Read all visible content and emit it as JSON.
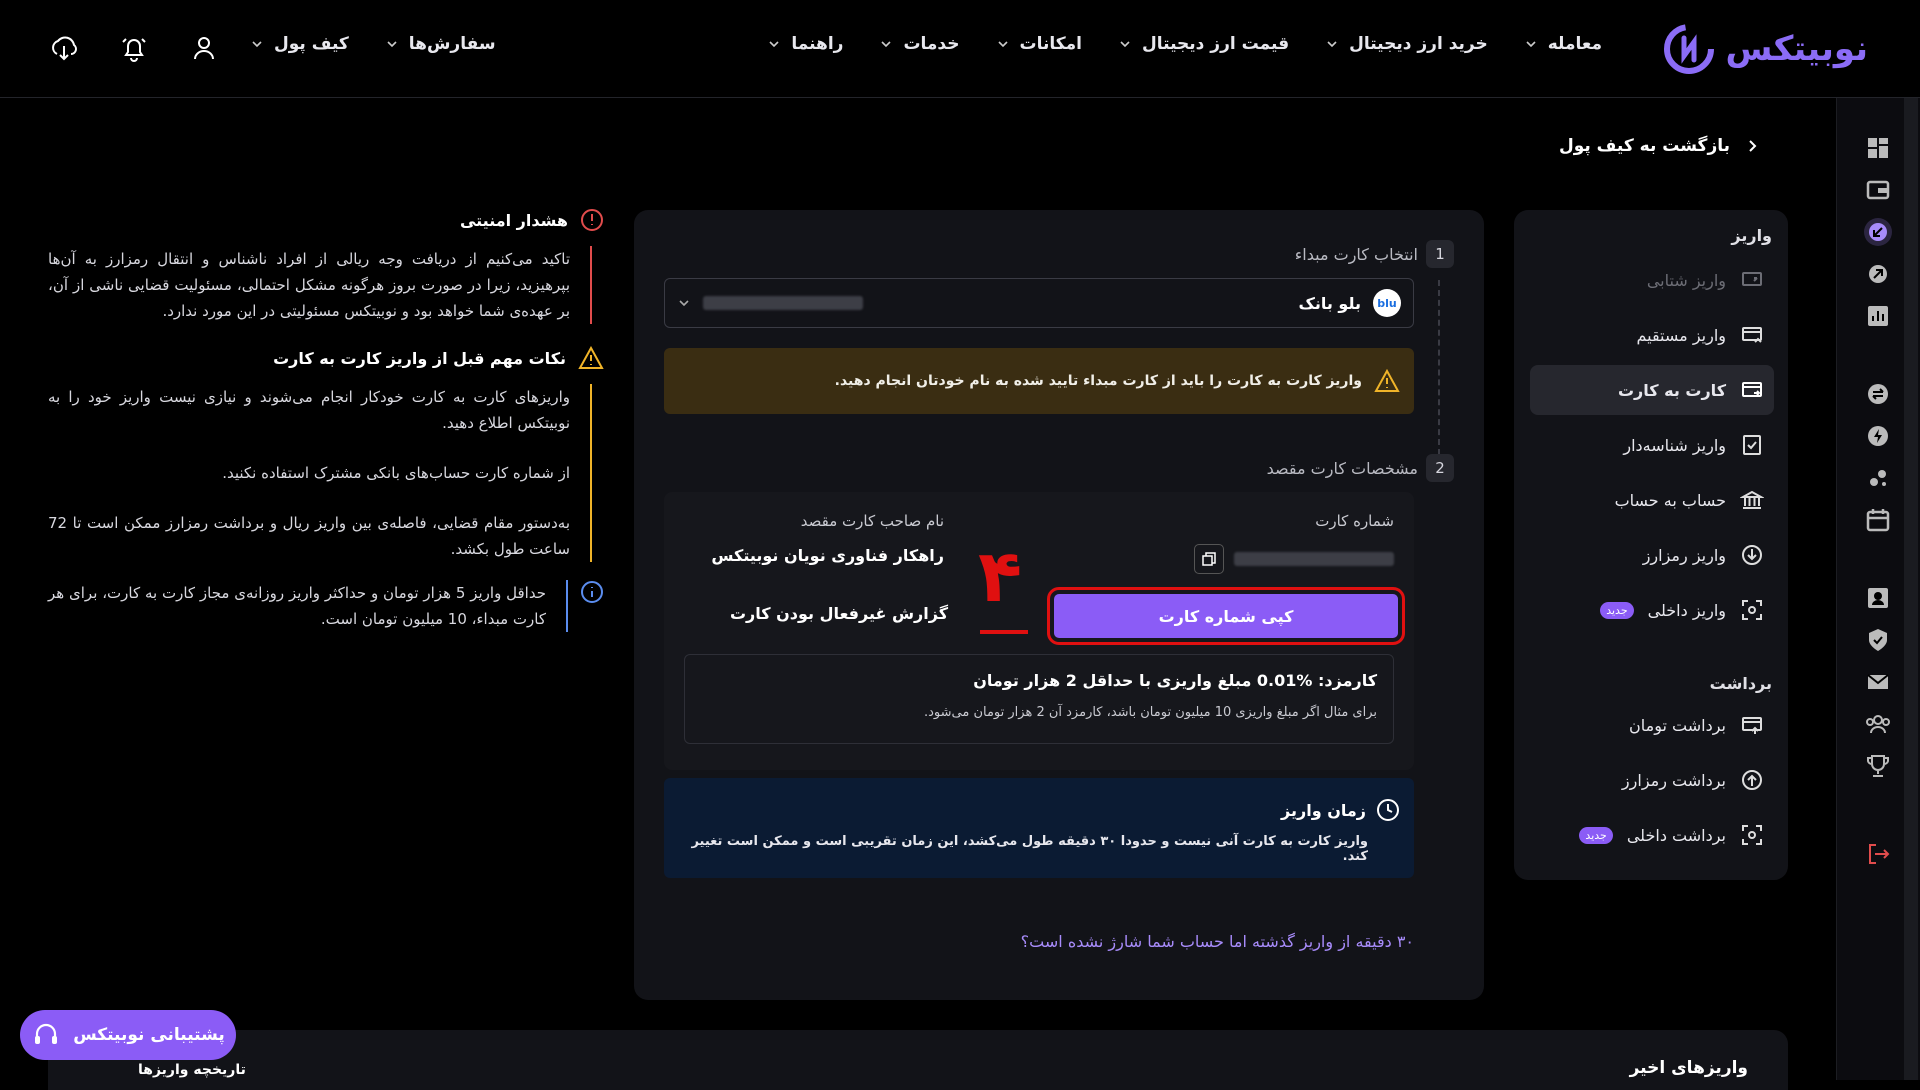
{
  "brand": {
    "name": "نوبیتکس",
    "color": "#8b6cf6"
  },
  "nav": {
    "items": [
      {
        "label": "معامله"
      },
      {
        "label": "خرید ارز دیجیتال"
      },
      {
        "label": "قیمت ارز دیجیتال"
      },
      {
        "label": "امکانات"
      },
      {
        "label": "خدمات"
      },
      {
        "label": "راهنما"
      }
    ],
    "left_items": [
      {
        "label": "سفارش‌ها"
      },
      {
        "label": "کیف پول"
      }
    ]
  },
  "breadcrumb": {
    "label": "بازگشت به کیف پول"
  },
  "sidebar": {
    "deposit_section": "واریز",
    "deposit_items": [
      {
        "label": "واریز شتابی",
        "icon": "fast-deposit-icon",
        "state": "disabled"
      },
      {
        "label": "واریز مستقیم",
        "icon": "direct-deposit-icon"
      },
      {
        "label": "کارت به کارت",
        "icon": "card-to-card-icon",
        "state": "active"
      },
      {
        "label": "واریز شناسه‌دار",
        "icon": "id-deposit-icon"
      },
      {
        "label": "حساب به حساب",
        "icon": "bank-icon"
      },
      {
        "label": "واریز رمزارز",
        "icon": "crypto-deposit-icon"
      },
      {
        "label": "واریز داخلی",
        "icon": "internal-deposit-icon",
        "badge": "جدید"
      }
    ],
    "withdraw_section": "برداشت",
    "withdraw_items": [
      {
        "label": "برداشت تومان",
        "icon": "toman-withdraw-icon"
      },
      {
        "label": "برداشت رمزارز",
        "icon": "crypto-withdraw-icon"
      },
      {
        "label": "برداشت داخلی",
        "icon": "internal-withdraw-icon",
        "badge": "جدید"
      }
    ]
  },
  "steps": {
    "step1": {
      "num": "1",
      "label": "انتخاب کارت مبداء"
    },
    "step2": {
      "num": "2",
      "label": "مشخصات کارت مقصد"
    }
  },
  "source_card": {
    "bank_logo": "blu",
    "bank_name": "بلو بانک"
  },
  "warning": {
    "text": "واریز کارت به کارت را باید از کارت مبداء تایید شده به نام خودتان انجام دهید."
  },
  "destination": {
    "card_number_label": "شماره کارت",
    "owner_label": "نام صاحب کارت مقصد",
    "owner_name": "راهکار فناوری نویان نوبیتکس",
    "copy_button": "کپی شماره کارت",
    "report_label": "گزارش غیرفعال بودن کارت"
  },
  "fee": {
    "title": "کارمزد: %0.01 مبلغ واریزی با حداقل 2 هزار تومان",
    "body": "برای مثال اگر مبلغ واریزی 10 میلیون تومان باشد، کارمزد آن 2 هزار تومان می‌شود."
  },
  "time": {
    "title": "زمان واریز",
    "body": "واریز کارت به کارت آنی نیست و حدودا ۳۰ دقیقه طول می‌کشد، این زمان تقریبی است و ممکن است تغییر کند."
  },
  "help_link": "۳۰ دقیقه از واریز گذشته اما حساب شما شارژ نشده است؟",
  "tips": {
    "security_title": "هشدار امنیتی",
    "security_body": "تاکید می‌کنیم از دریافت وجه ریالی از افراد ناشناس و انتقال رمزارز به آن‌ها بپرهیزید، زیرا در صورت بروز هرگونه مشکل احتمالی، مسئولیت قضایی ناشی از آن، بر عهده‌ی شما خواهد بود و نوبیتکس مسئولیتی در این مورد ندارد.",
    "notes_title": "نکات مهم قبل از واریز کارت به کارت",
    "note1": "واریزهای کارت به کارت خودکار انجام می‌شوند و نیازی نیست واریز خود را به نوبیتکس اطلاع دهید.",
    "note2": "از شماره کارت حساب‌های بانکی مشترک استفاده نکنید.",
    "note3": "به‌دستور مقام قضایی، فاصله‌ی بین واریز ریال و برداشت رمزارز ممکن است تا 72 ساعت طول بکشد.",
    "limit": "حداقل واریز 5 هزار تومان و حداکثر واریز روزانه‌ی مجاز کارت به کارت، برای هر کارت مبداء، 10 میلیون تومان است."
  },
  "annotation": {
    "label": "۴",
    "color": "#e01010"
  },
  "support": {
    "label": "پشتیبانی نوبیتکس"
  },
  "bottom": {
    "recent": "واریزهای اخیر",
    "history": "تاریخچه واریزها"
  },
  "colors": {
    "accent": "#8b5cf6",
    "warning_bg": "#3a2d12",
    "info_bg": "#0b1b33",
    "danger": "#e01010"
  }
}
